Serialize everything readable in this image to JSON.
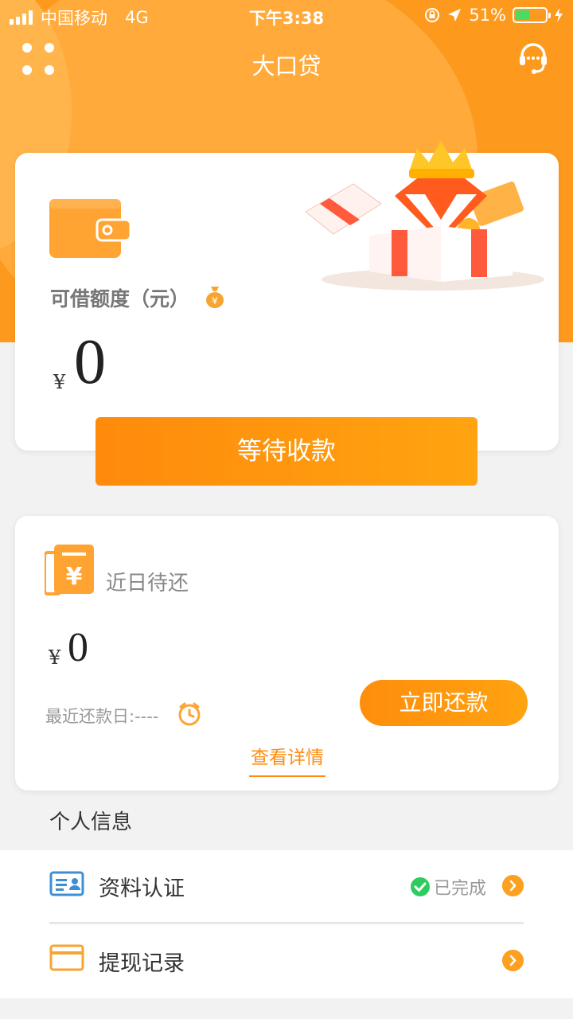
{
  "status_bar": {
    "carrier": "中国移动",
    "network": "4G",
    "time": "下午3:38",
    "battery": "51%",
    "battery_level": 0.51
  },
  "nav": {
    "title": "大口贷"
  },
  "credit_card": {
    "label": "可借额度（元）",
    "currency": "¥",
    "amount": "0"
  },
  "wait_button": {
    "label": "等待收款"
  },
  "repay_card": {
    "label": "近日待还",
    "currency": "¥",
    "amount": "0",
    "due_date": "最近还款日:----",
    "repay_button": "立即还款",
    "detail_link": "查看详情"
  },
  "personal": {
    "section_title": "个人信息",
    "items": [
      {
        "label": "资料认证",
        "status": "已完成",
        "icon": "id-card-icon"
      },
      {
        "label": "提现记录",
        "status": "",
        "icon": "card-icon"
      }
    ]
  },
  "colors": {
    "brand": "#fd9a1e",
    "button": "#ff8a0c",
    "success": "#2ecc5e"
  }
}
